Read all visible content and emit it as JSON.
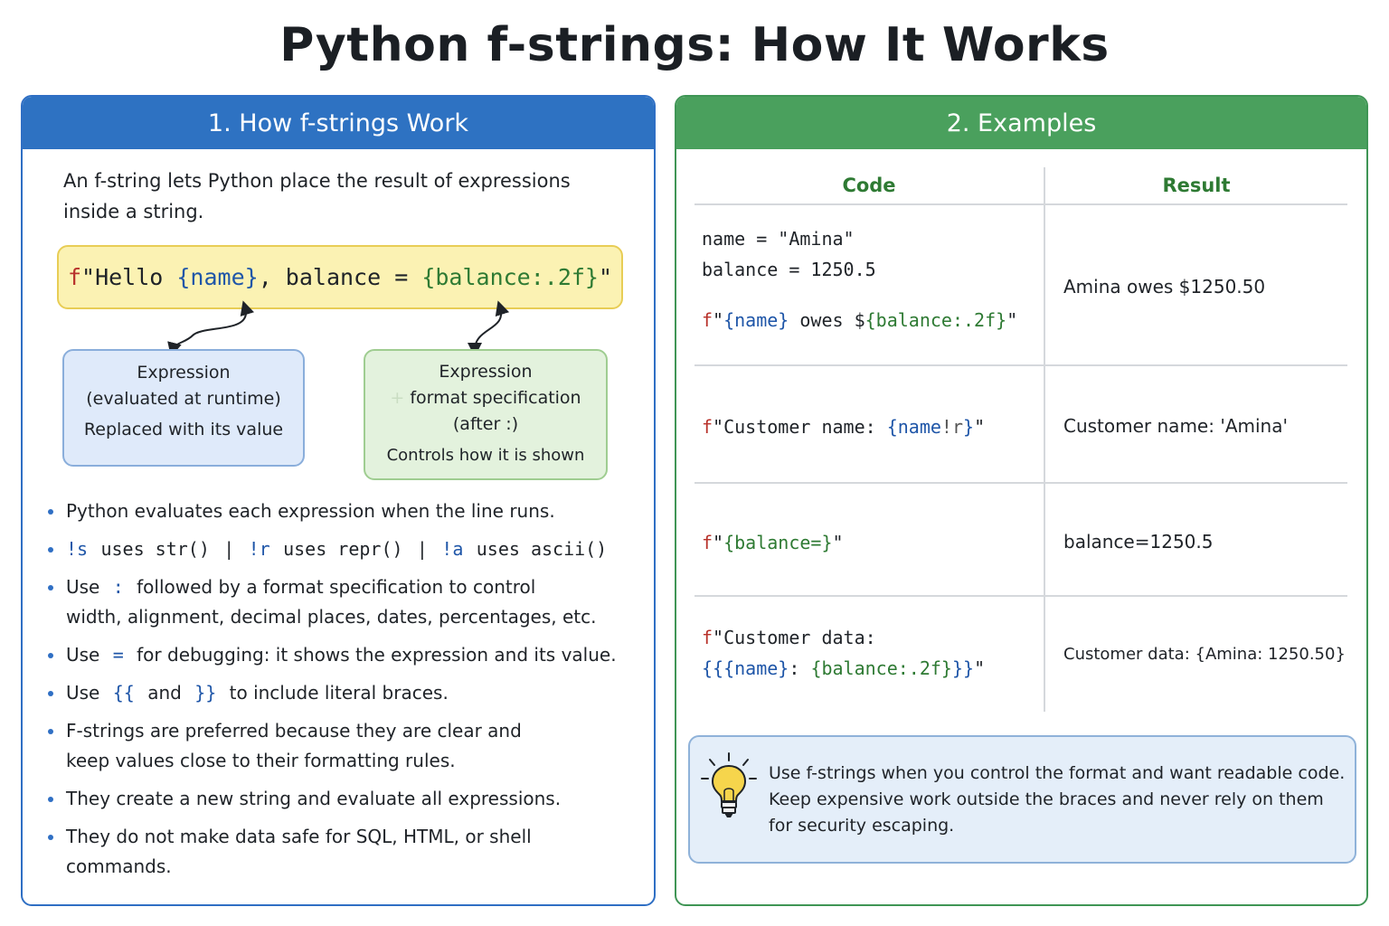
{
  "title": "Python f-strings: How It Works",
  "left_panel": {
    "header": "1. How f-strings Work",
    "intro_line1": "An f-string lets Python place the result of expressions",
    "intro_line2": "inside a string.",
    "code": {
      "prefix": "f",
      "quote_open": "\"Hello ",
      "expr1": "{name}",
      "middle": ", balance = ",
      "expr2": "{balance:.2f}",
      "quote_close": "\""
    },
    "note_expression": {
      "line1": "Expression",
      "line2": "(evaluated at runtime)",
      "line3": "Replaced with its value"
    },
    "note_format": {
      "line1": "Expression",
      "plus": "+",
      "line2": "format specification",
      "line3": "(after :)",
      "line4": "Controls how it is shown"
    },
    "bullets": {
      "b1": "Python evaluates each expression when the line runs.",
      "b2": {
        "s_code": "!s",
        "s_text": "uses str()",
        "sep": "|",
        "r_code": "!r",
        "r_text": "uses repr()",
        "a_code": "!a",
        "a_text": "uses ascii()"
      },
      "b3": {
        "pre": "Use",
        "code": ":",
        "post": "followed by a format specification to control",
        "line2": "width, alignment, decimal places, dates, percentages, etc."
      },
      "b4": {
        "pre": "Use",
        "code": "=",
        "post": "for debugging: it shows the expression and its value."
      },
      "b5": {
        "pre": "Use",
        "code1": "{{",
        "mid": "and",
        "code2": "}}",
        "post": "to include literal braces."
      },
      "b6": {
        "line1": "F-strings are preferred because they are clear and",
        "line2": "keep values close to their formatting rules."
      },
      "b7": "They create a new string and evaluate all expressions.",
      "b8": "They do not make data safe for SQL, HTML, or shell commands."
    }
  },
  "right_panel": {
    "header": "2. Examples",
    "col_code": "Code",
    "col_result": "Result",
    "rows": {
      "r1": {
        "line1": "name = \"Amina\"",
        "line2": "balance = 1250.5",
        "f": "f",
        "q1": "\"",
        "e1": "{name}",
        "mid": " owes $",
        "e2": "{balance:.2f}",
        "q2": "\"",
        "result": "Amina owes $1250.50"
      },
      "r2": {
        "f": "f",
        "text": "\"Customer name: ",
        "e1": "{name",
        "conv": "!r",
        "close": "}",
        "q2": "\"",
        "result": "Customer name: 'Amina'"
      },
      "r3": {
        "f": "f",
        "q1": "\"",
        "e1": "{balance=}",
        "q2": "\"",
        "result": "balance=1250.5"
      },
      "r4": {
        "f": "f",
        "text": "\"Customer data:",
        "braces_open": "{{",
        "e1": "{name}",
        "colon": ": ",
        "e2": "{balance:.2f}",
        "braces_close": "}}",
        "q2": "\"",
        "result": "Customer data: {Amina: 1250.50}"
      }
    },
    "tip": {
      "icon": "lightbulb-icon",
      "line1": "Use f-strings when you control the format and want readable code.",
      "line2": "Keep expensive work outside the braces and never rely on them",
      "line3": "for security escaping."
    }
  },
  "colors": {
    "left_accent": "#2e72c2",
    "right_accent": "#4aa05d",
    "code_blue": "#1f56a8",
    "code_green": "#2e7a33",
    "code_red": "#b8322b",
    "code_box_fill": "#fbf2b3"
  }
}
